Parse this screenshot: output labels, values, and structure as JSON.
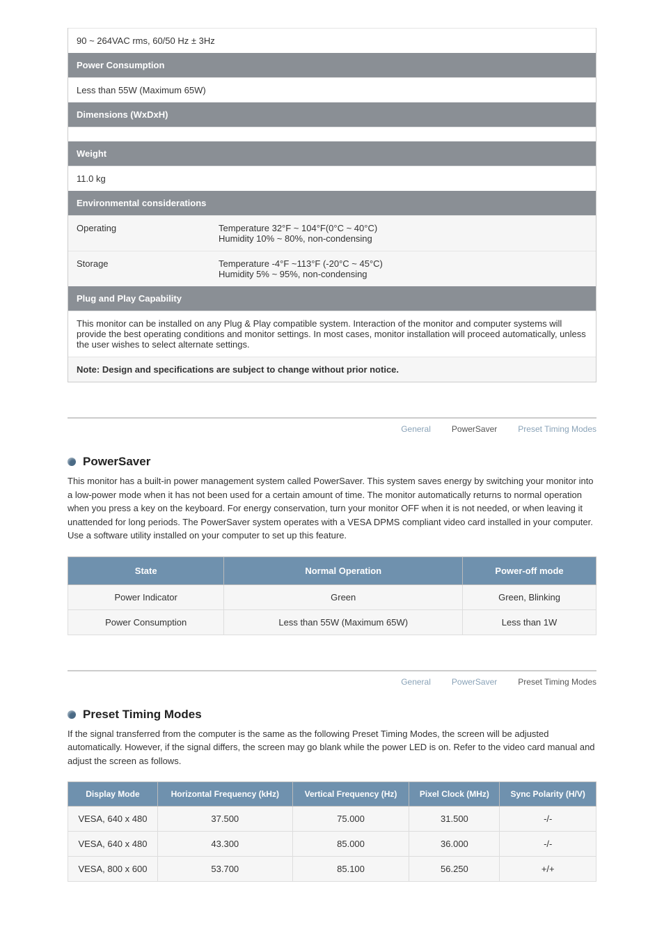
{
  "specs": {
    "input_signal": "90 ~ 264VAC rms, 60/50 Hz ± 3Hz",
    "power_consumption_hdr": "Power Consumption",
    "power_consumption": "Less than 55W (Maximum 65W)",
    "dimensions_hdr": "Dimensions (WxDxH)",
    "dimensions": "",
    "weight_hdr": "Weight",
    "weight": "11.0 kg",
    "env_hdr": "Environmental considerations",
    "env_op_label": "Operating",
    "env_op_val_1": "Temperature 32°F ~ 104°F(0°C ~ 40°C)",
    "env_op_val_2": "Humidity 10% ~ 80%, non-condensing",
    "env_st_label": "Storage",
    "env_st_val_1": "Temperature -4°F ~113°F (-20°C ~ 45°C)",
    "env_st_val_2": "Humidity 5% ~ 95%, non-condensing",
    "pnp_hdr": "Plug and Play Capability",
    "pnp_body": "This monitor can be installed on any Plug & Play compatible system. Interaction of the monitor and computer systems will provide the best operating conditions and monitor settings. In most cases, monitor installation will proceed automatically, unless the user wishes to select alternate settings.",
    "note": "Note: Design and specifications are subject to change without prior notice."
  },
  "tabs1": {
    "general": "General",
    "powersaver": "PowerSaver",
    "timing": "Preset Timing Modes"
  },
  "tabs2": {
    "general": "General",
    "powersaver": "PowerSaver",
    "timing": "Preset Timing Modes"
  },
  "powersaver": {
    "title": "PowerSaver",
    "body": "This monitor has a built-in power management system called PowerSaver. This system saves energy by switching your monitor into a low-power mode when it has not been used for a certain amount of time. The monitor automatically returns to normal operation when you press a key on the keyboard. For energy conservation, turn your monitor OFF when it is not needed, or when leaving it unattended for long periods. The PowerSaver system operates with a VESA DPMS compliant video card installed in your computer. Use a software utility installed on your computer to set up this feature.",
    "headers": {
      "state": "State",
      "normal": "Normal Operation",
      "off": "Power-off mode"
    },
    "rows": {
      "r1": {
        "a": "Power Indicator",
        "b": "Green",
        "c": "Green, Blinking"
      },
      "r2": {
        "a": "Power Consumption",
        "b": "Less than 55W (Maximum 65W)",
        "c": "Less than 1W"
      }
    }
  },
  "timing": {
    "title": "Preset Timing Modes",
    "body": "If the signal transferred from the computer is the same as the following Preset Timing Modes, the screen will be adjusted automatically. However, if the signal differs, the screen may go blank while the power LED is on. Refer to the video card manual and adjust the screen as follows.",
    "headers": {
      "mode": "Display Mode",
      "hfreq": "Horizontal Frequency (kHz)",
      "vfreq": "Vertical Frequency (Hz)",
      "clock": "Pixel Clock (MHz)",
      "sync": "Sync Polarity (H/V)"
    },
    "rows": {
      "r1": {
        "a": "VESA, 640 x 480",
        "b": "37.500",
        "c": "75.000",
        "d": "31.500",
        "e": "-/-"
      },
      "r2": {
        "a": "VESA, 640 x 480",
        "b": "43.300",
        "c": "85.000",
        "d": "36.000",
        "e": "-/-"
      },
      "r3": {
        "a": "VESA, 800 x 600",
        "b": "53.700",
        "c": "85.100",
        "d": "56.250",
        "e": "+/+"
      }
    }
  },
  "chart_data": [
    {
      "type": "table",
      "title": "PowerSaver",
      "columns": [
        "State",
        "Normal Operation",
        "Power-off mode"
      ],
      "rows": [
        [
          "Power Indicator",
          "Green",
          "Green, Blinking"
        ],
        [
          "Power Consumption",
          "Less than 55W (Maximum 65W)",
          "Less than 1W"
        ]
      ]
    },
    {
      "type": "table",
      "title": "Preset Timing Modes",
      "columns": [
        "Display Mode",
        "Horizontal Frequency (kHz)",
        "Vertical Frequency (Hz)",
        "Pixel Clock (MHz)",
        "Sync Polarity (H/V)"
      ],
      "rows": [
        [
          "VESA, 640 x 480",
          37.5,
          75.0,
          31.5,
          "-/-"
        ],
        [
          "VESA, 640 x 480",
          43.3,
          85.0,
          36.0,
          "-/-"
        ],
        [
          "VESA, 800 x 600",
          53.7,
          85.1,
          56.25,
          "+/+"
        ]
      ]
    }
  ]
}
